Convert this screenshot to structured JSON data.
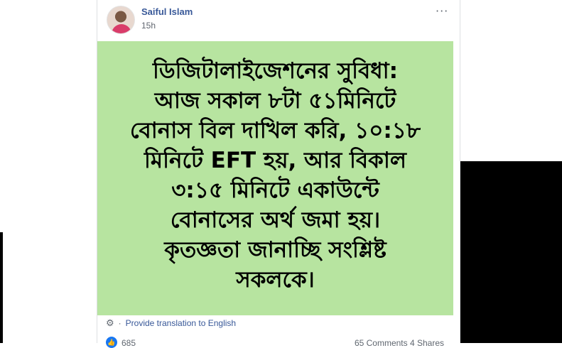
{
  "post": {
    "author": "Saiful Islam",
    "time": "15h",
    "more_icon": "···",
    "body_lines": [
      "ডিজিটালাইজেশনের সুবিধা:",
      "আজ সকাল ৮টা ৫১মিনিটে",
      "বোনাস বিল দাখিল করি, ১০:১৮",
      "মিনিটে EFT হয়, আর বিকাল",
      "৩:১৫ মিনিটে একাউন্টে",
      "বোনাসের অর্থ জমা হয়।",
      "কৃতজ্ঞতা জানাচ্ছি সংশ্লিষ্ট",
      "সকলকে।"
    ],
    "background_color": "#b7e4a0"
  },
  "translation": {
    "gear_icon": "gear-icon",
    "separator": "·",
    "label": "Provide translation to English"
  },
  "footer": {
    "like_count": "685",
    "stats": "65 Comments  4 Shares"
  }
}
